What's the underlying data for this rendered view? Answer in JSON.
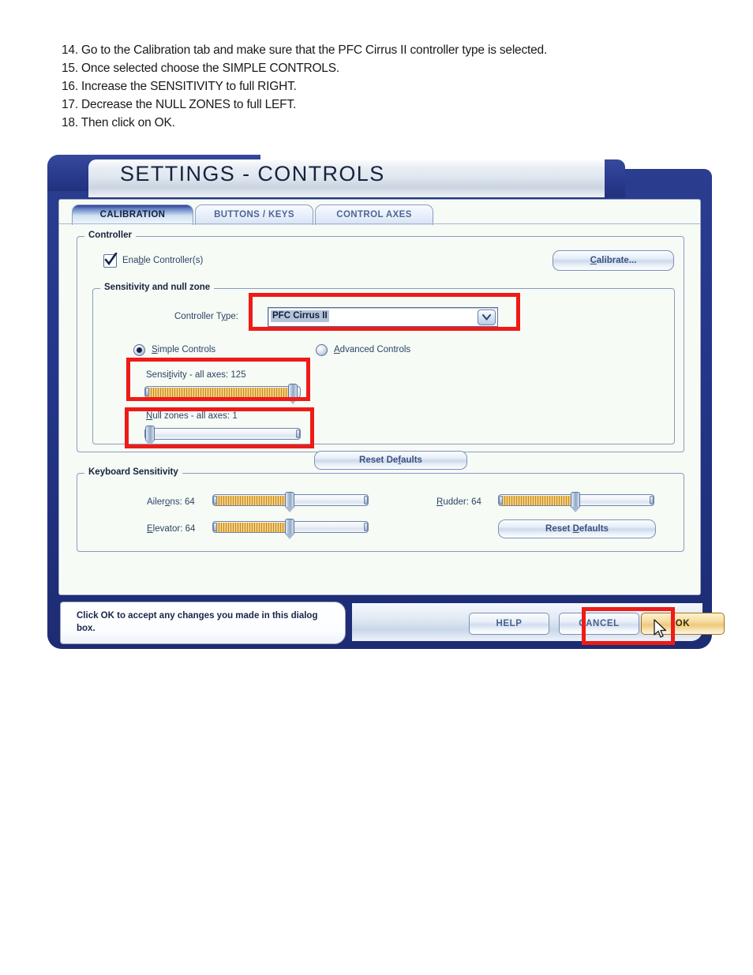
{
  "instructions": [
    "14. Go to the Calibration tab and make sure that the PFC Cirrus II controller type is selected.",
    "15. Once selected choose the SIMPLE CONTROLS.",
    "16. Increase the SENSITIVITY to full RIGHT.",
    "17. Decrease the NULL ZONES to full LEFT.",
    "18. Then click on OK."
  ],
  "dialog": {
    "title": "SETTINGS - CONTROLS",
    "tabs": [
      {
        "label": "CALIBRATION",
        "active": true
      },
      {
        "label": "BUTTONS / KEYS",
        "active": false
      },
      {
        "label": "CONTROL AXES",
        "active": false
      }
    ],
    "controller_group": {
      "title": "Controller",
      "enable_checkbox": {
        "label": "Enable Controller(s)",
        "checked": true,
        "accel": "b"
      },
      "calibrate_button": {
        "label": "Calibrate...",
        "accel": "C"
      }
    },
    "sensitivity_group": {
      "title": "Sensitivity and null zone",
      "controller_type_label": "Controller Type:",
      "controller_type_value": "PFC Cirrus II",
      "radio_simple": {
        "label": "Simple Controls",
        "selected": true,
        "accel": "S"
      },
      "radio_advanced": {
        "label": "Advanced Controls",
        "selected": false,
        "accel": "A"
      },
      "sensitivity_slider": {
        "label": "Sensitivity - all axes: 125",
        "value": 125,
        "min": 1,
        "max": 125,
        "percent": 100
      },
      "nullzone_slider": {
        "label": "Null zones - all axes: 1",
        "value": 1,
        "min": 1,
        "max": 125,
        "percent": 0
      },
      "reset_button": {
        "label": "Reset Defaults",
        "accel": "f"
      }
    },
    "keyboard_group": {
      "title": "Keyboard Sensitivity",
      "ailerons": {
        "label": "Ailerons: 64",
        "value": 64,
        "percent": 50
      },
      "elevator": {
        "label": "Elevator: 64",
        "value": 64,
        "percent": 50
      },
      "rudder": {
        "label": "Rudder: 64",
        "value": 64,
        "percent": 50
      },
      "reset_button": {
        "label": "Reset Defaults",
        "accel": "D"
      }
    },
    "status_text": "Click OK to accept any changes you made in this dialog box.",
    "buttons": {
      "help": "HELP",
      "cancel": "CANCEL",
      "ok": "OK"
    }
  },
  "colors": {
    "navy": "#2a3d8f",
    "panel_bg": "#f6fbf5",
    "annotation_red": "#ee1b17",
    "slider_fill": "#c98a1e",
    "ok_highlight": "#edc97c"
  }
}
